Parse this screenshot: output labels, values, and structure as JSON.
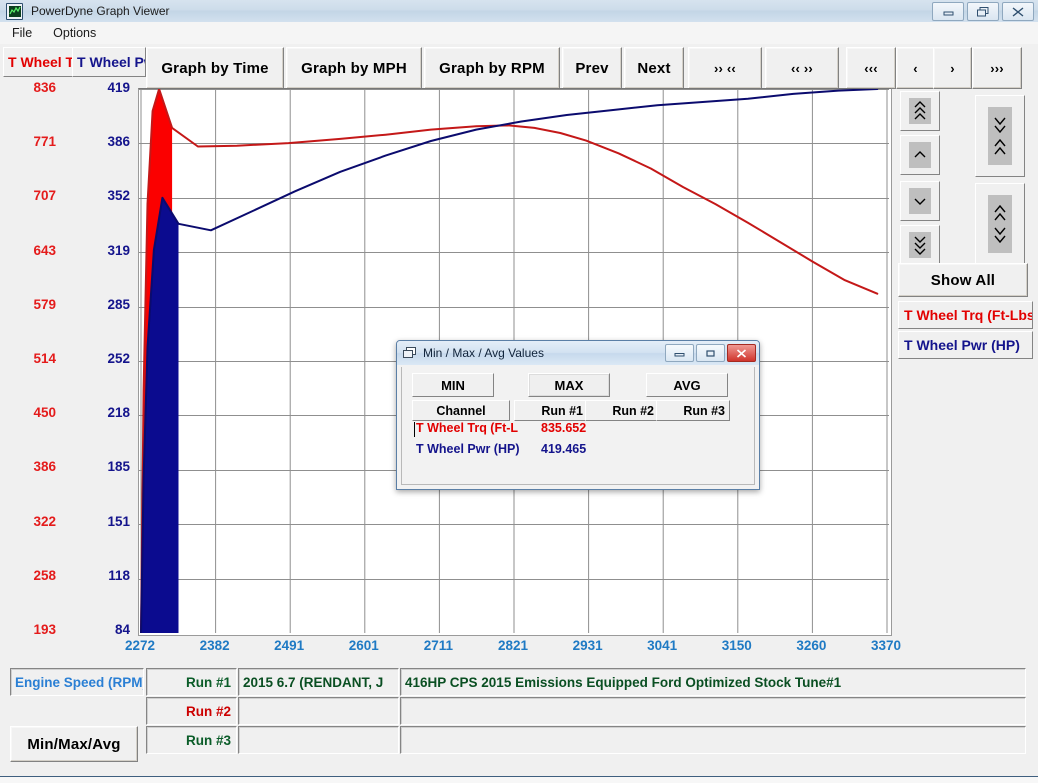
{
  "window": {
    "title": "PowerDyne Graph Viewer",
    "icon": "graph-app-icon",
    "buttons": {
      "minimize": "minimize-icon",
      "maximize": "restore-icon",
      "close": "close-icon"
    }
  },
  "menu": {
    "items": [
      {
        "label": "File"
      },
      {
        "label": "Options"
      }
    ]
  },
  "toolbar": {
    "channel_tabs": [
      {
        "label": "T Wheel Trq (Ft-Lbs)",
        "color": "#e20000"
      },
      {
        "label": "T Wheel Pwr (HP)",
        "color": "#14148c"
      }
    ],
    "buttons": [
      {
        "label": "Graph by Time",
        "name": "graph-by-time-button"
      },
      {
        "label": "Graph by MPH",
        "name": "graph-by-mph-button"
      },
      {
        "label": "Graph by RPM",
        "name": "graph-by-rpm-button"
      },
      {
        "label": "Prev",
        "name": "prev-button"
      },
      {
        "label": "Next",
        "name": "next-button"
      },
      {
        "label": "›› ‹‹",
        "name": "zoom-in-button"
      },
      {
        "label": "‹‹ ››",
        "name": "zoom-out-button"
      },
      {
        "label": "‹‹‹",
        "name": "scroll-left-fast-button"
      },
      {
        "label": "‹",
        "name": "scroll-left-button"
      },
      {
        "label": "›",
        "name": "scroll-right-button"
      },
      {
        "label": "›››",
        "name": "scroll-right-fast-button"
      }
    ]
  },
  "right_panel": {
    "show_all": "Show All",
    "legend": [
      {
        "label": "T Wheel Trq (Ft-Lbs)",
        "color": "#e20000"
      },
      {
        "label": "T Wheel Pwr (HP)",
        "color": "#14148c"
      }
    ],
    "nav_buttons": [
      {
        "name": "scale-up-fast-button",
        "glyph": "double-chevron-up-icon"
      },
      {
        "name": "scale-up-button",
        "glyph": "chevron-up-icon"
      },
      {
        "name": "scale-down-button",
        "glyph": "chevron-down-icon"
      },
      {
        "name": "scale-down-fast-button",
        "glyph": "double-chevron-down-icon"
      },
      {
        "name": "range-compress-button",
        "glyph": "chevron-down-up-icon"
      },
      {
        "name": "range-expand-button",
        "glyph": "chevron-up-down-icon"
      }
    ]
  },
  "bottom": {
    "x_channel": "Engine Speed (RPM)",
    "minmaxavg_button": "Min/Max/Avg",
    "runs": [
      {
        "label": "Run #1",
        "color": "#0a5c28",
        "file": "2015 6.7 (RENDANT, J",
        "description": "416HP CPS 2015 Emissions Equipped Ford Optimized Stock Tune#1"
      },
      {
        "label": "Run #2",
        "color": "#cc0000",
        "file": "",
        "description": ""
      },
      {
        "label": "Run #3",
        "color": "#0a5c28",
        "file": "",
        "description": ""
      }
    ]
  },
  "dialog": {
    "title": "Min / Max / Avg Values",
    "icon": "window-stack-icon",
    "buttons": {
      "minimize": "minimize-icon",
      "maximize": "maximize-icon",
      "close": "close-icon"
    },
    "modes": [
      {
        "label": "MIN",
        "selected": false
      },
      {
        "label": "MAX",
        "selected": true
      },
      {
        "label": "AVG",
        "selected": false
      }
    ],
    "headers": [
      "Channel",
      "Run #1",
      "Run #2",
      "Run #3"
    ],
    "rows": [
      {
        "channel": "T Wheel Trq (Ft-L",
        "color": "#e20000",
        "run1": "835.652",
        "run2": "",
        "run3": ""
      },
      {
        "channel": "T Wheel Pwr (HP)",
        "color": "#14148c",
        "run1": "419.465",
        "run2": "",
        "run3": ""
      }
    ]
  },
  "chart_data": {
    "type": "line",
    "title": "",
    "xlabel": "Engine Speed (RPM)",
    "grid": true,
    "legend_position": "right",
    "x_ticks": [
      2272,
      2382,
      2491,
      2601,
      2711,
      2821,
      2931,
      3041,
      3150,
      3260,
      3370
    ],
    "xlim": [
      2272,
      3425
    ],
    "axes": [
      {
        "name": "T Wheel Trq (Ft-Lbs)",
        "color": "#e41b1b",
        "ticks": [
          836,
          771,
          707,
          643,
          579,
          514,
          450,
          386,
          322,
          258,
          193
        ],
        "ylim": [
          193,
          836
        ]
      },
      {
        "name": "T Wheel Pwr (HP)",
        "color": "#14148c",
        "ticks": [
          419,
          386,
          352,
          319,
          285,
          252,
          218,
          185,
          151,
          118,
          84
        ],
        "ylim": [
          84,
          419
        ]
      }
    ],
    "series": [
      {
        "name": "T Wheel Trq (Ft-Lbs)",
        "color": "#c41818",
        "axis": 0,
        "max": 835.652,
        "x": [
          2272,
          2276,
          2282,
          2290,
          2300,
          2320,
          2360,
          2420,
          2500,
          2580,
          2650,
          2720,
          2790,
          2840,
          2880,
          2920,
          2960,
          3010,
          3060,
          3110,
          3160,
          3210,
          3260,
          3310,
          3360,
          3410
        ],
        "values": [
          193,
          480,
          700,
          810,
          836,
          790,
          768,
          769,
          772,
          777,
          782,
          788,
          792,
          793,
          790,
          784,
          775,
          760,
          742,
          720,
          700,
          678,
          655,
          632,
          610,
          594
        ]
      },
      {
        "name": "T Wheel Pwr (HP)",
        "color": "#0b0b6e",
        "axis": 1,
        "max": 419.465,
        "x": [
          2272,
          2276,
          2282,
          2292,
          2305,
          2330,
          2380,
          2440,
          2510,
          2580,
          2650,
          2720,
          2790,
          2860,
          2930,
          3000,
          3070,
          3140,
          3210,
          3280,
          3350,
          3410
        ],
        "values": [
          84,
          180,
          260,
          320,
          352,
          336,
          332,
          343,
          356,
          368,
          378,
          387,
          394,
          399,
          403,
          406,
          409,
          411,
          413,
          416,
          418,
          419
        ]
      }
    ]
  }
}
